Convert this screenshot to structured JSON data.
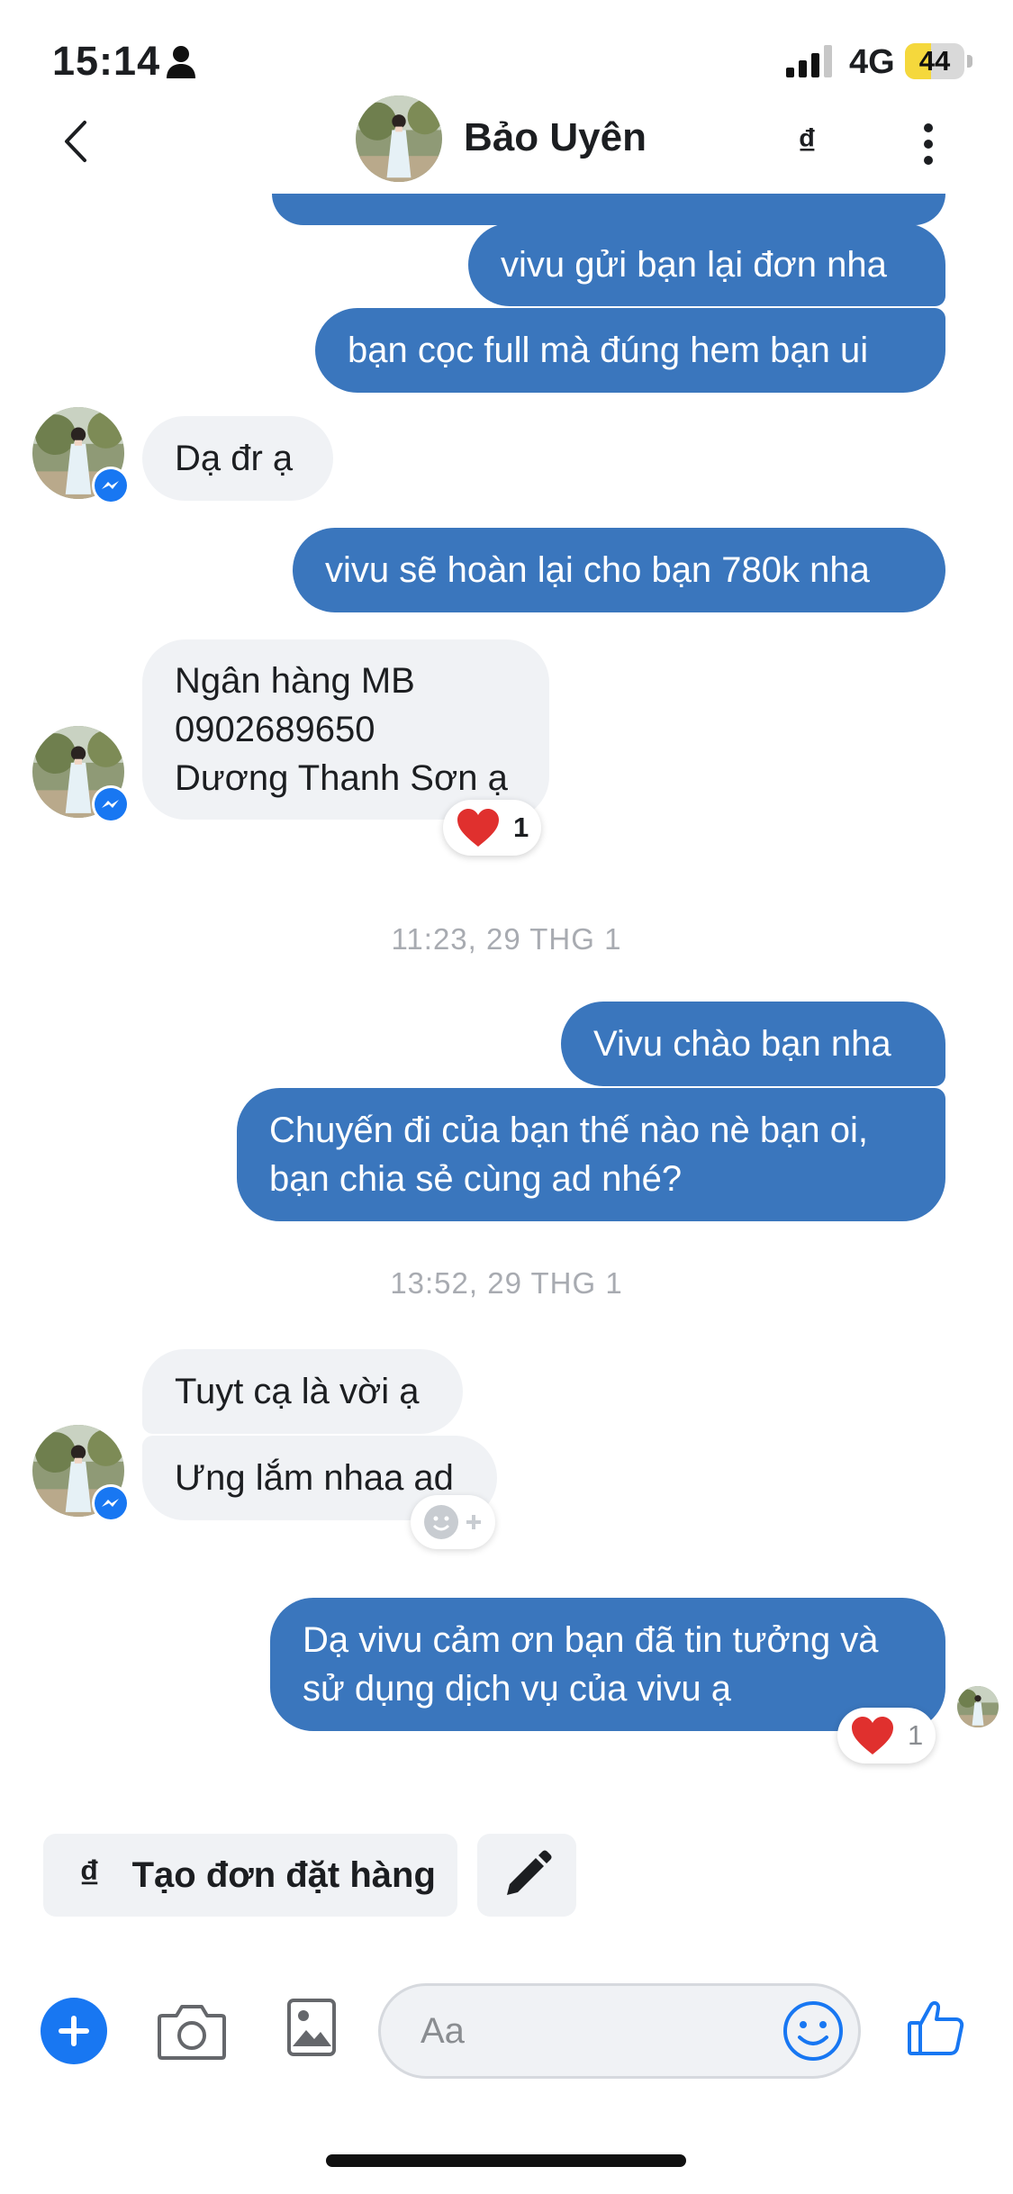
{
  "status_bar": {
    "time": "15:14",
    "network": "4G",
    "battery": "44",
    "battery_level": 0.44
  },
  "header": {
    "contact_name": "Bảo Uyên",
    "currency_symbol": "₫"
  },
  "messages": {
    "out_1": "vivu gửi bạn lại đơn nha",
    "out_2": "bạn cọc full mà đúng hem bạn ui",
    "in_1": "Dạ đr ạ",
    "out_3": "vivu sẽ hoàn lại cho bạn 780k nha",
    "in_2_line1": "Ngân hàng MB",
    "in_2_line2": "0902689650",
    "in_2_line3": "Dương Thanh Sơn ạ",
    "in_2_reaction_count": "1",
    "timestamp_1": "11:23, 29 THG 1",
    "out_4": "Vivu chào bạn nha",
    "out_5_line1": "Chuyến đi của bạn thế nào nè bạn oi,",
    "out_5_line2": "bạn chia sẻ cùng ad nhé?",
    "timestamp_2": "13:52, 29 THG 1",
    "in_3": "Tuyt cạ là vời ạ",
    "in_4": "Ưng lắm nhaa ad",
    "out_6_line1": "Dạ vivu cảm ơn bạn đã tin tưởng và",
    "out_6_line2": "sử dụng dịch vụ của vivu ạ",
    "out_6_reaction_count": "1"
  },
  "quick_actions": {
    "order_symbol": "₫",
    "order_label": "Tạo đơn đặt hàng"
  },
  "composer": {
    "placeholder": "Aa"
  },
  "colors": {
    "outgoing_bubble": "#3a76bd",
    "incoming_bubble": "#f0f2f5",
    "accent": "#1877f2",
    "battery_fill": "#f5d83c"
  }
}
